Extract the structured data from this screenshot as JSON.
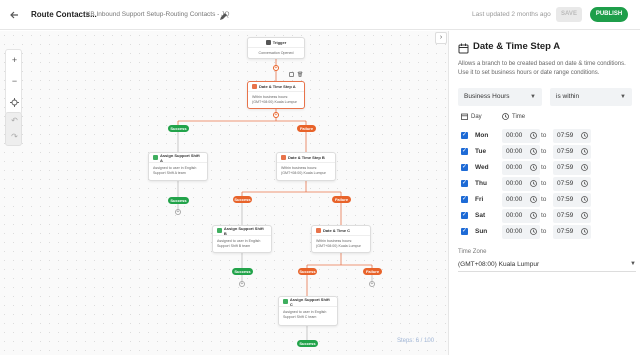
{
  "header": {
    "title": "Route Contacts...",
    "subtitle": "KB Inbound Support Setup-Routing Contacts - JQ",
    "last_updated": "Last updated 2 months ago",
    "save_label": "SAVE",
    "publish_label": "PUBLISH"
  },
  "canvas": {
    "steps_counter": "Steps: 6 / 100",
    "zoom_in": "+",
    "zoom_out": "−",
    "nodes": {
      "trigger": {
        "title": "Trigger",
        "body": "Conversation Opened"
      },
      "dt_a": {
        "title": "Date & Time Step A",
        "body1": "Within business hours:",
        "body2": "(GMT+08:00) Kuala Lumpur"
      },
      "assign_a": {
        "title": "Assign Support Shift A",
        "body1": "Assigned to user in English",
        "body2": "Support Shift A team"
      },
      "dt_b": {
        "title": "Date & Time Step B",
        "body1": "Within business hours:",
        "body2": "(GMT+08:00) Kuala Lumpur"
      },
      "assign_b": {
        "title": "Assign Support Shift B",
        "body1": "Assigned to user in English",
        "body2": "Support Shift B team"
      },
      "dt_c": {
        "title": "Date & Time C",
        "body1": "Within business hours:",
        "body2": "(GMT+08:00) Kuala Lumpur"
      },
      "assign_c": {
        "title": "Assign Support Shift C",
        "body1": "Assigned to user in English",
        "body2": "Support Shift C team"
      }
    },
    "labels": {
      "success": "Success",
      "failure": "Failure"
    }
  },
  "panel": {
    "title": "Date & Time Step A",
    "description": "Allows a branch to be created based on date & time conditions. Use it to set business hours or date range conditions.",
    "condition_type": "Business Hours",
    "operator": "is within",
    "col_day": "Day",
    "col_time": "Time",
    "to_label": "to",
    "rows": [
      {
        "day": "Mon",
        "from": "00:00",
        "to": "07:59"
      },
      {
        "day": "Tue",
        "from": "00:00",
        "to": "07:59"
      },
      {
        "day": "Wed",
        "from": "00:00",
        "to": "07:59"
      },
      {
        "day": "Thu",
        "from": "00:00",
        "to": "07:59"
      },
      {
        "day": "Fri",
        "from": "00:00",
        "to": "07:59"
      },
      {
        "day": "Sat",
        "from": "00:00",
        "to": "07:59"
      },
      {
        "day": "Sun",
        "from": "00:00",
        "to": "07:59"
      }
    ],
    "timezone_label": "Time Zone",
    "timezone_value": "(GMT+08:00) Kuala Lumpur"
  },
  "colors": {
    "accent_green": "#1e9e4a",
    "failure_orange": "#e8632a",
    "checkbox_blue": "#1e6bd6"
  }
}
